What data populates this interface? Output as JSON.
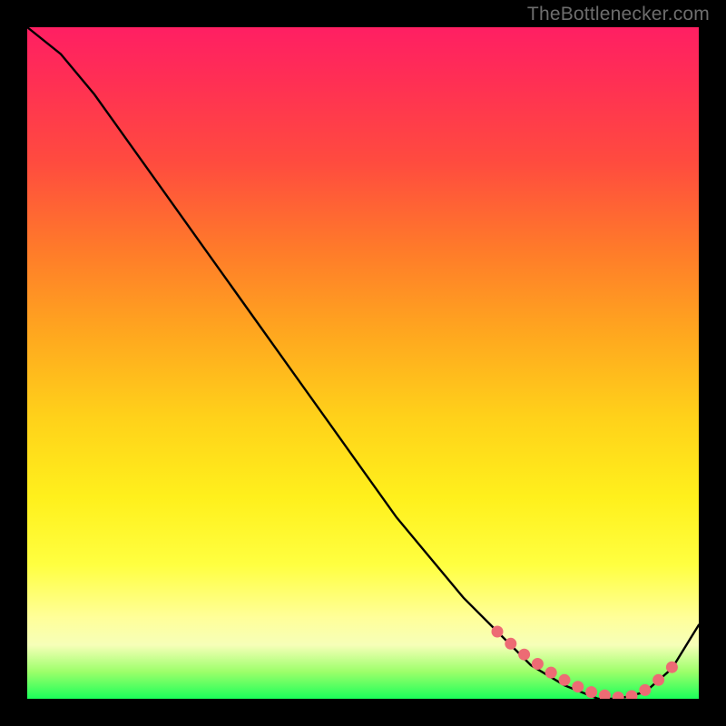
{
  "watermark": "TheBottlenecker.com",
  "colors": {
    "curve": "#000000",
    "marker": "#ed6b74",
    "gradient_top": "#ff1f63",
    "gradient_bottom": "#1bff5a"
  },
  "chart_data": {
    "type": "line",
    "title": "",
    "xlabel": "",
    "ylabel": "",
    "xlim": [
      0,
      100
    ],
    "ylim": [
      0,
      100
    ],
    "series": [
      {
        "name": "bottleneck-curve",
        "x": [
          0,
          5,
          10,
          15,
          20,
          25,
          30,
          35,
          40,
          45,
          50,
          55,
          60,
          65,
          70,
          75,
          80,
          85,
          88,
          92,
          96,
          100
        ],
        "y": [
          100,
          96,
          90,
          83,
          76,
          69,
          62,
          55,
          48,
          41,
          34,
          27,
          21,
          15,
          10,
          5,
          2,
          0,
          0,
          1,
          4.5,
          11
        ]
      }
    ],
    "markers": {
      "name": "highlighted-points",
      "x": [
        70,
        72,
        74,
        76,
        78,
        80,
        82,
        84,
        86,
        88,
        90,
        92,
        94,
        96
      ],
      "y": [
        10,
        8.2,
        6.6,
        5.2,
        3.9,
        2.8,
        1.8,
        1.0,
        0.5,
        0.2,
        0.4,
        1.3,
        2.8,
        4.7
      ]
    }
  }
}
